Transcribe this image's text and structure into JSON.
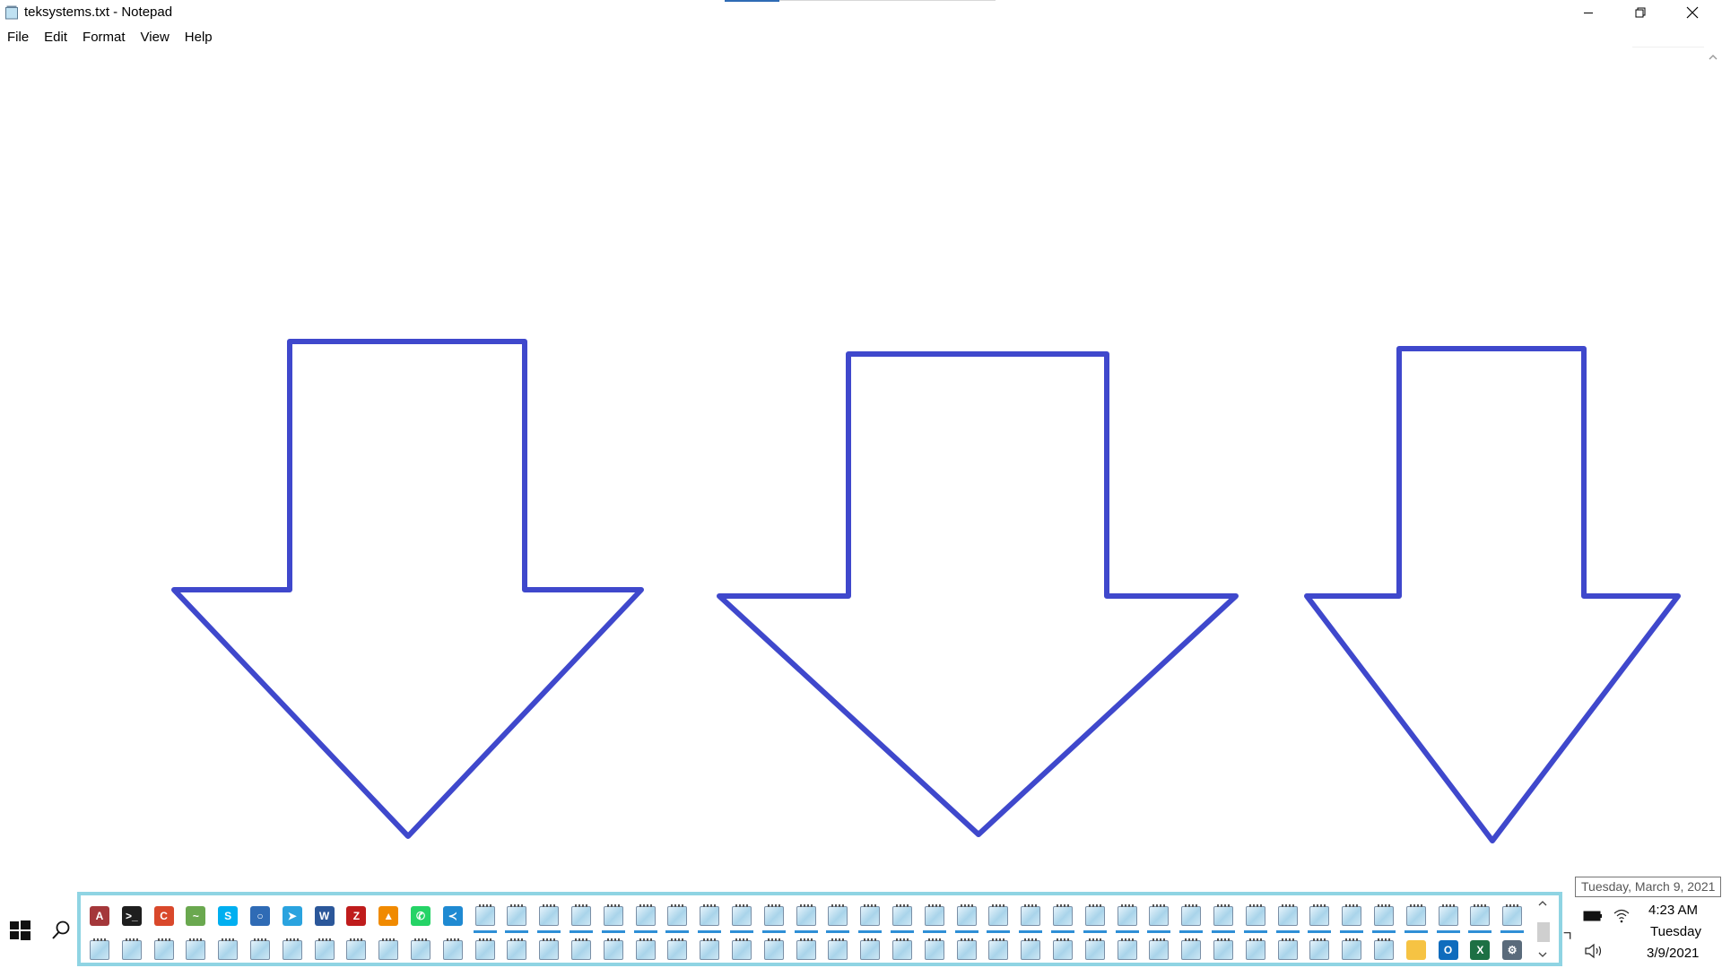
{
  "window": {
    "title": "teksystems.txt - Notepad",
    "icon": "notepad-icon",
    "buttons": [
      "minimize-icon",
      "restore-icon",
      "close-icon"
    ]
  },
  "menu": {
    "items": [
      {
        "label": "File"
      },
      {
        "label": "Edit"
      },
      {
        "label": "Format"
      },
      {
        "label": "View"
      },
      {
        "label": "Help"
      }
    ]
  },
  "editor": {
    "text": "",
    "drawing": {
      "shape": "down-arrow-outline",
      "count": 3,
      "stroke_color": "#3f48cc",
      "fill_color": "#ffffff"
    }
  },
  "taskbar": {
    "pinned_apps": [
      {
        "name": "Access",
        "icon": "access-icon",
        "glyph": "A",
        "color": "#a4373a"
      },
      {
        "name": "Terminal",
        "icon": "terminal-icon",
        "glyph": ">_",
        "color": "#1e1e1e"
      },
      {
        "name": "CCleaner",
        "icon": "ccleaner-icon",
        "glyph": "C",
        "color": "#d9482b"
      },
      {
        "name": "Task Manager",
        "icon": "chart-icon",
        "glyph": "~",
        "color": "#6aa84f"
      },
      {
        "name": "Skype",
        "icon": "skype-icon",
        "glyph": "S",
        "color": "#00aff0"
      },
      {
        "name": "Chat",
        "icon": "chat-icon",
        "glyph": "○",
        "color": "#2f6bb5"
      },
      {
        "name": "Telegram",
        "icon": "telegram-icon",
        "glyph": "➤",
        "color": "#2aa3df"
      },
      {
        "name": "Word",
        "icon": "word-icon",
        "glyph": "W",
        "color": "#2b579a"
      },
      {
        "name": "FileZilla",
        "icon": "filezilla-icon",
        "glyph": "Z",
        "color": "#bf1c1c"
      },
      {
        "name": "VLC",
        "icon": "vlc-icon",
        "glyph": "▲",
        "color": "#f08a00"
      },
      {
        "name": "WhatsApp",
        "icon": "whatsapp-icon",
        "glyph": "✆",
        "color": "#25d366"
      },
      {
        "name": "VS Code",
        "icon": "vscode-icon",
        "glyph": "≺",
        "color": "#1f8ad2"
      }
    ],
    "notepad_windows_row1": 33,
    "notepad_windows_row2": 41,
    "row2_extra_apps": [
      {
        "name": "File Explorer",
        "icon": "folder-icon",
        "glyph": "",
        "color": "#f6c343"
      },
      {
        "name": "Outlook",
        "icon": "outlook-icon",
        "glyph": "O",
        "color": "#0f6cbd"
      },
      {
        "name": "Excel",
        "icon": "excel-icon",
        "glyph": "X",
        "color": "#1d7044"
      },
      {
        "name": "Control Panel",
        "icon": "control-panel-icon",
        "glyph": "⚙",
        "color": "#5a6b7b"
      }
    ]
  },
  "tray": {
    "icons": [
      "chevron-up-icon",
      "battery-icon",
      "wifi-icon",
      "volume-icon"
    ],
    "time": "4:23 AM",
    "day": "Tuesday",
    "date": "3/9/2021",
    "tooltip": "Tuesday, March 9, 2021"
  }
}
